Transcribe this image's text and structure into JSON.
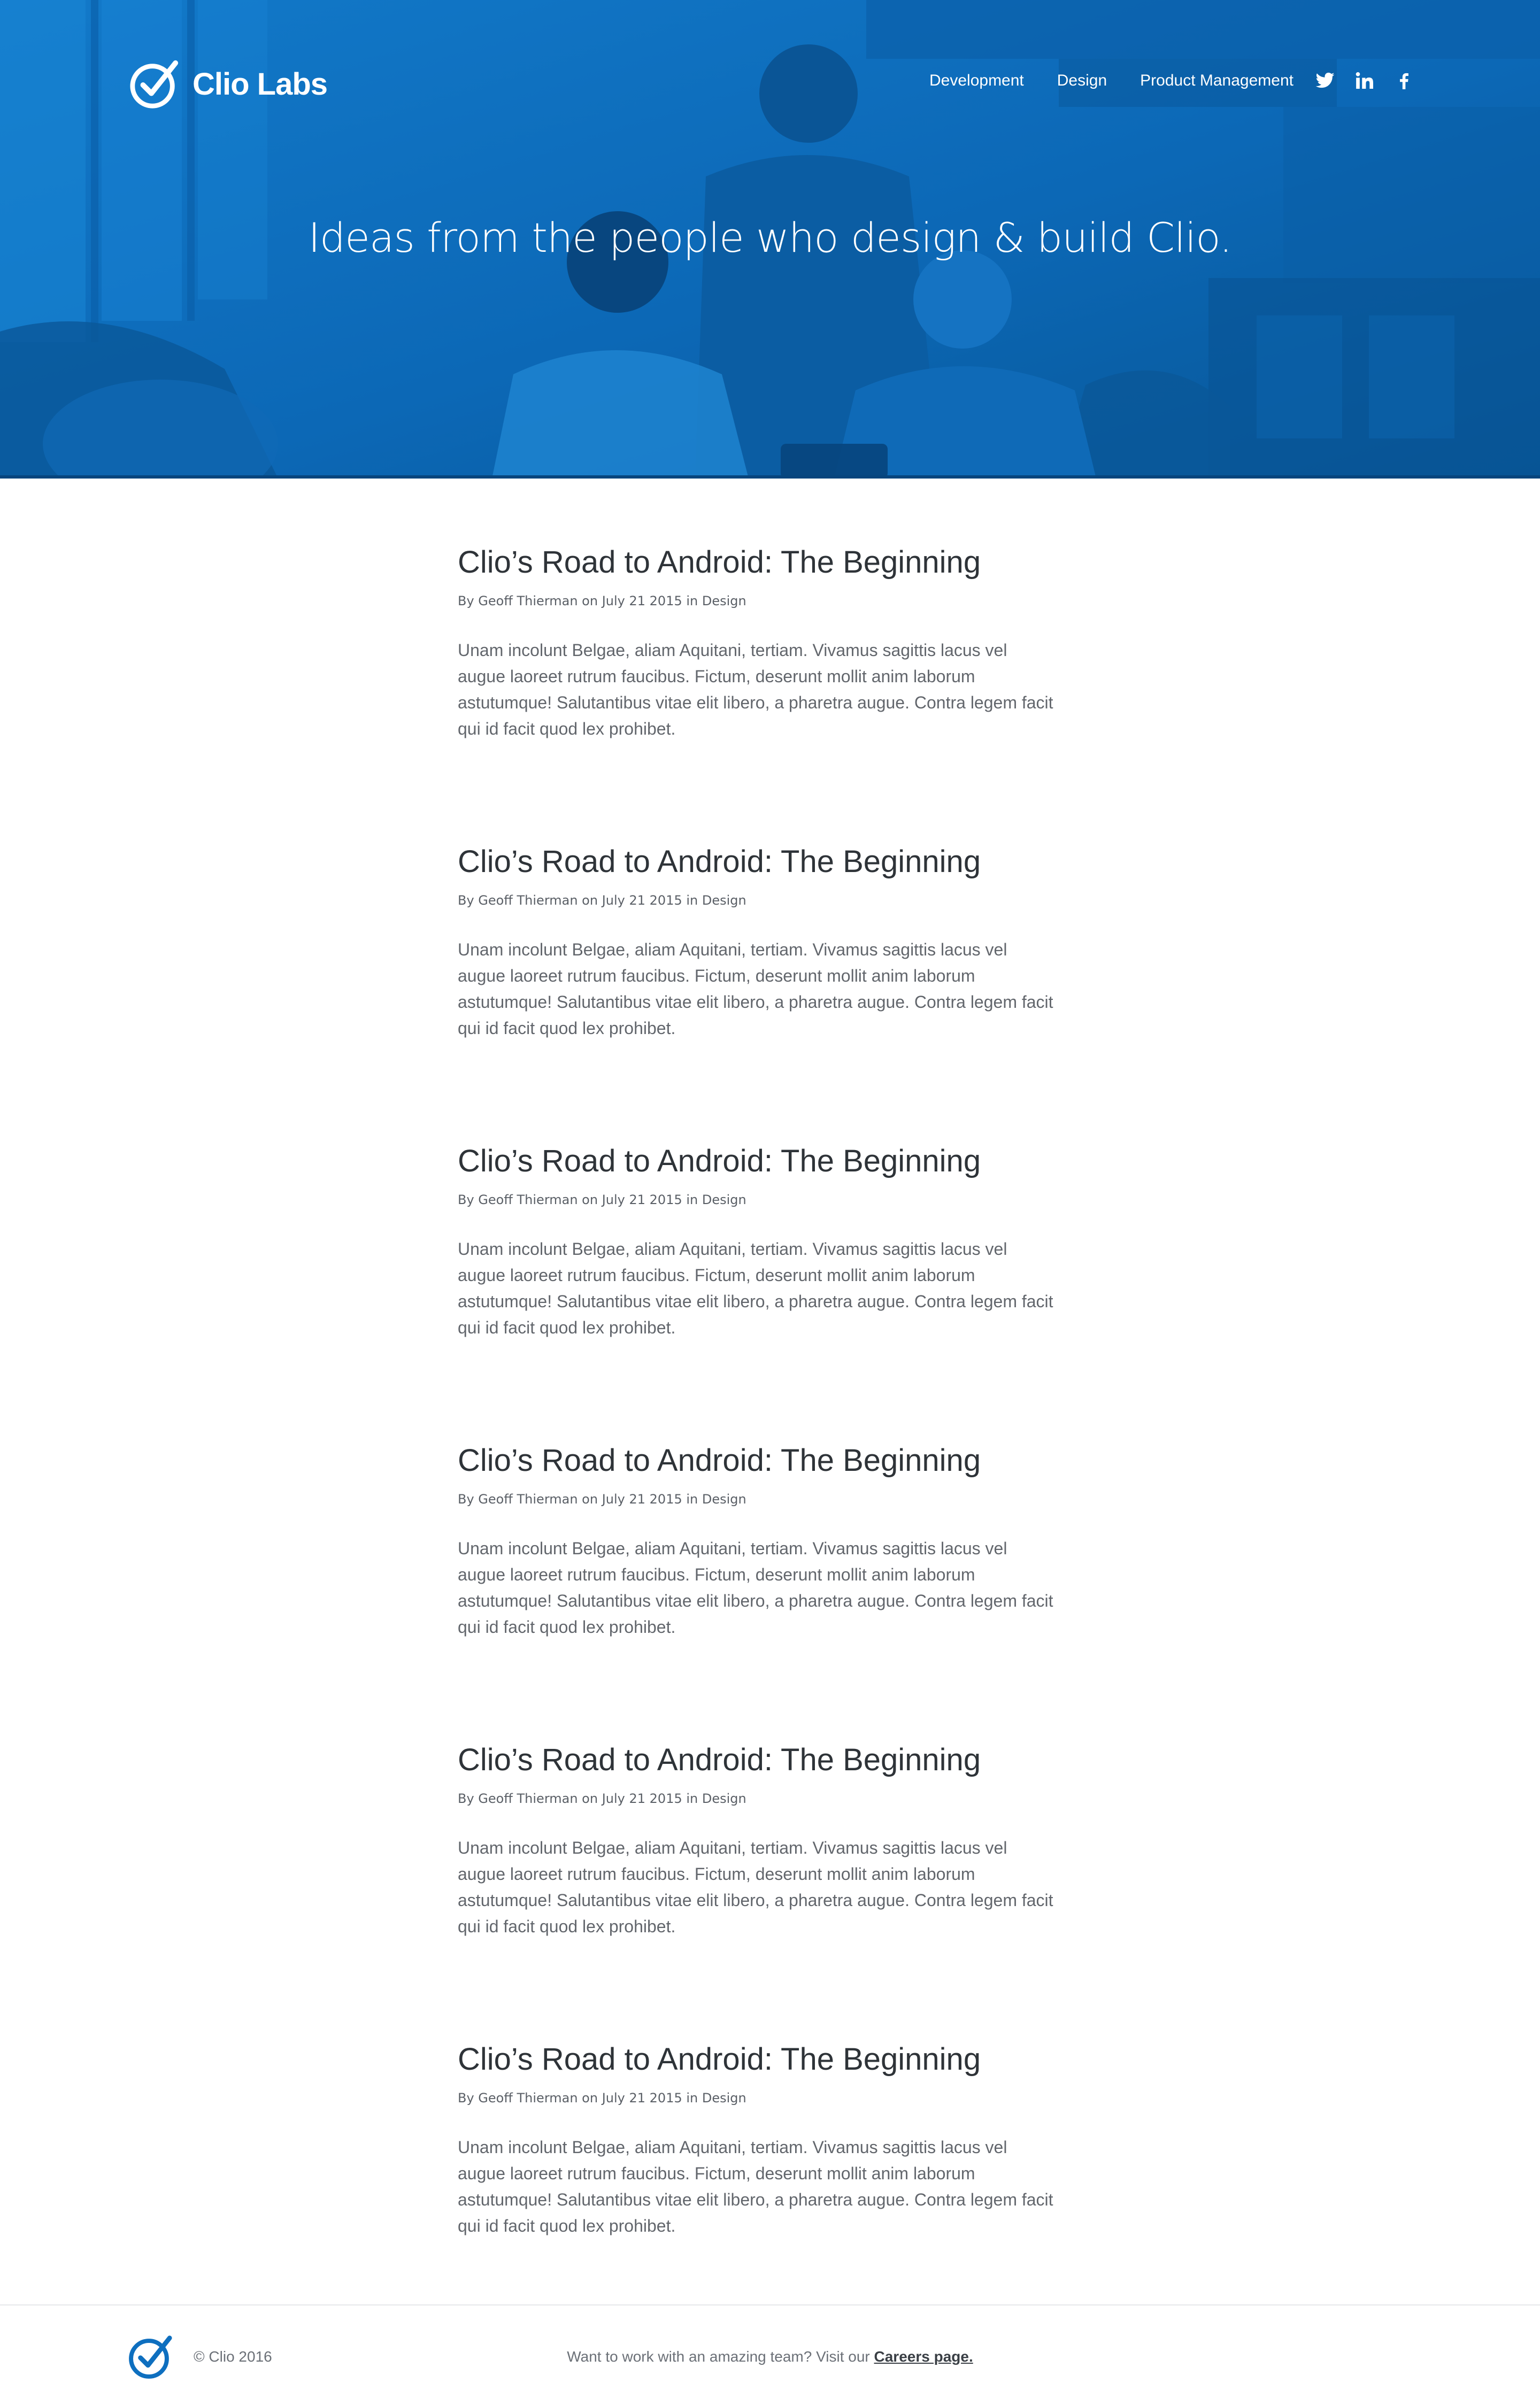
{
  "brand": {
    "name": "Clio Labs",
    "accent": "#0e6fbf",
    "dark_accent": "#07457d"
  },
  "nav": {
    "items": [
      {
        "label": "Development"
      },
      {
        "label": "Design"
      },
      {
        "label": "Product Management"
      }
    ],
    "social": [
      "twitter-icon",
      "linkedin-icon",
      "facebook-icon"
    ]
  },
  "hero": {
    "tagline": "Ideas from the people who design & build Clio."
  },
  "posts": [
    {
      "title": "Clio’s Road to Android: The Beginning",
      "meta": "By Geoff Thierman on July 21 2015 in Design",
      "excerpt": "Unam incolunt Belgae, aliam Aquitani, tertiam. Vivamus sagittis lacus vel augue laoreet rutrum faucibus. Fictum,  deserunt mollit anim laborum astutumque! Salutantibus vitae elit libero, a pharetra augue. Contra legem facit qui id facit quod lex prohibet."
    },
    {
      "title": "Clio’s Road to Android: The Beginning",
      "meta": "By Geoff Thierman on July 21 2015 in Design",
      "excerpt": "Unam incolunt Belgae, aliam Aquitani, tertiam. Vivamus sagittis lacus vel augue laoreet rutrum faucibus. Fictum,  deserunt mollit anim laborum astutumque! Salutantibus vitae elit libero, a pharetra augue. Contra legem facit qui id facit quod lex prohibet."
    },
    {
      "title": "Clio’s Road to Android: The Beginning",
      "meta": "By Geoff Thierman on July 21 2015 in Design",
      "excerpt": "Unam incolunt Belgae, aliam Aquitani, tertiam. Vivamus sagittis lacus vel augue laoreet rutrum faucibus. Fictum,  deserunt mollit anim laborum astutumque! Salutantibus vitae elit libero, a pharetra augue. Contra legem facit qui id facit quod lex prohibet."
    },
    {
      "title": "Clio’s Road to Android: The Beginning",
      "meta": "By Geoff Thierman on July 21 2015 in Design",
      "excerpt": "Unam incolunt Belgae, aliam Aquitani, tertiam. Vivamus sagittis lacus vel augue laoreet rutrum faucibus. Fictum,  deserunt mollit anim laborum astutumque! Salutantibus vitae elit libero, a pharetra augue. Contra legem facit qui id facit quod lex prohibet."
    },
    {
      "title": "Clio’s Road to Android: The Beginning",
      "meta": "By Geoff Thierman on July 21 2015 in Design",
      "excerpt": "Unam incolunt Belgae, aliam Aquitani, tertiam. Vivamus sagittis lacus vel augue laoreet rutrum faucibus. Fictum,  deserunt mollit anim laborum astutumque! Salutantibus vitae elit libero, a pharetra augue. Contra legem facit qui id facit quod lex prohibet."
    },
    {
      "title": "Clio’s Road to Android: The Beginning",
      "meta": "By Geoff Thierman on July 21 2015 in Design",
      "excerpt": "Unam incolunt Belgae, aliam Aquitani, tertiam. Vivamus sagittis lacus vel augue laoreet rutrum faucibus. Fictum,  deserunt mollit anim laborum astutumque! Salutantibus vitae elit libero, a pharetra augue. Contra legem facit qui id facit quod lex prohibet."
    }
  ],
  "footer": {
    "copyright": "© Clio 2016",
    "cta_text": "Want to work with an amazing team? Visit our ",
    "cta_link": "Careers page."
  }
}
